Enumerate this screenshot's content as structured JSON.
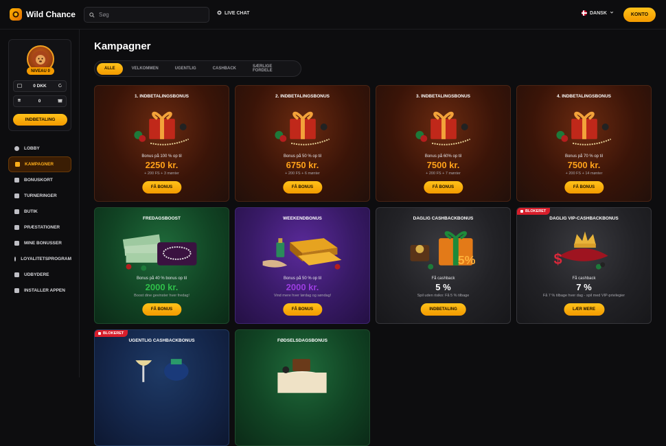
{
  "app": {
    "name": "Wild Chance"
  },
  "search": {
    "placeholder": "Søg"
  },
  "header": {
    "live_chat": "LIVE CHAT",
    "language": "DANSK",
    "account_button": "KONTO"
  },
  "profile": {
    "level": "NIVEAU 0",
    "balance": "0 DKK",
    "bonus_balance": "0",
    "deposit_button": "INDBETALING"
  },
  "sidebar": {
    "items": [
      {
        "label": "LOBBY",
        "icon": "lobby-icon",
        "active": false
      },
      {
        "label": "KAMPAGNER",
        "icon": "campaign-icon",
        "active": true
      },
      {
        "label": "BONUSKORT",
        "icon": "card-icon",
        "active": false
      },
      {
        "label": "TURNERINGER",
        "icon": "trophy-icon",
        "active": false
      },
      {
        "label": "BUTIK",
        "icon": "shop-icon",
        "active": false
      },
      {
        "label": "PRÆSTATIONER",
        "icon": "medal-icon",
        "active": false
      },
      {
        "label": "MINE BONUSSER",
        "icon": "gift-icon",
        "active": false
      },
      {
        "label": "LOYALITETSPROGRAM",
        "icon": "heart-icon",
        "active": false
      },
      {
        "label": "UDBYDERE",
        "icon": "grid-icon",
        "active": false
      },
      {
        "label": "INSTALLER APPEN",
        "icon": "download-icon",
        "active": false
      }
    ]
  },
  "page": {
    "title": "Kampagner"
  },
  "filters": [
    "ALLE",
    "VELKOMMEN",
    "UGENTLIG",
    "CASHBACK",
    "SÆRLIGE FORDELE"
  ],
  "cards": [
    {
      "title": "1. INDBETALINGSBONUS",
      "subtitle": "Bonus på 100 % op til",
      "amount": "2250 kr.",
      "extra": "+ 200 FS + 3 mønter",
      "button": "FÅ BONUS",
      "theme": "red",
      "amount_color": "#ffa21a"
    },
    {
      "title": "2. INDBETALINGSBONUS",
      "subtitle": "Bonus på 50 % op til",
      "amount": "6750 kr.",
      "extra": "+ 200 FS + 6 mønter",
      "button": "FÅ BONUS",
      "theme": "red",
      "amount_color": "#ffa21a"
    },
    {
      "title": "3. INDBETALINGSBONUS",
      "subtitle": "Bonus på 60% op til",
      "amount": "7500 kr.",
      "extra": "+ 200 FS + 7 mønter",
      "button": "FÅ BONUS",
      "theme": "red",
      "amount_color": "#ffa21a"
    },
    {
      "title": "4. INDBETALINGSBONUS",
      "subtitle": "Bonus på 70 % op til",
      "amount": "7500 kr.",
      "extra": "+ 200 FS + 14 mønter",
      "button": "FÅ BONUS",
      "theme": "red",
      "amount_color": "#ffa21a"
    },
    {
      "title": "FREDAGSBOOST",
      "subtitle": "Bonus på 40 % bonus op til",
      "amount": "2000 kr.",
      "extra": "Boost dine gevinster hver fredag!",
      "button": "FÅ BONUS",
      "theme": "green",
      "amount_color": "#2fbf4a"
    },
    {
      "title": "WEEKENDBONUS",
      "subtitle": "Bonus på 50 % op til",
      "amount": "2000 kr.",
      "extra": "Vind mere hver lørdag og søndag!",
      "button": "FÅ BONUS",
      "theme": "purple",
      "amount_color": "#9b3de0"
    },
    {
      "title": "DAGLIG CASHBACKBONUS",
      "subtitle": "Få cashback",
      "amount": "5 %",
      "extra": "Spil uden risiko: Få 5 % tilbage",
      "button": "INDBETALING",
      "theme": "dark",
      "amount_color": "#ffffff"
    },
    {
      "title": "DAGLIG VIP-CASHBACKBONUS",
      "subtitle": "Få cashback",
      "amount": "7 %",
      "extra": "Få 7 % tilbage hver dag - spil med VIP-privilegier",
      "button": "LÆR MERE",
      "theme": "dark",
      "amount_color": "#ffffff",
      "badge": "BLOKERET"
    },
    {
      "title": "UGENTLIG CASHBACKBONUS",
      "theme": "navy",
      "badge": "BLOKERET"
    },
    {
      "title": "FØDSELSDAGSBONUS",
      "theme": "green"
    }
  ]
}
